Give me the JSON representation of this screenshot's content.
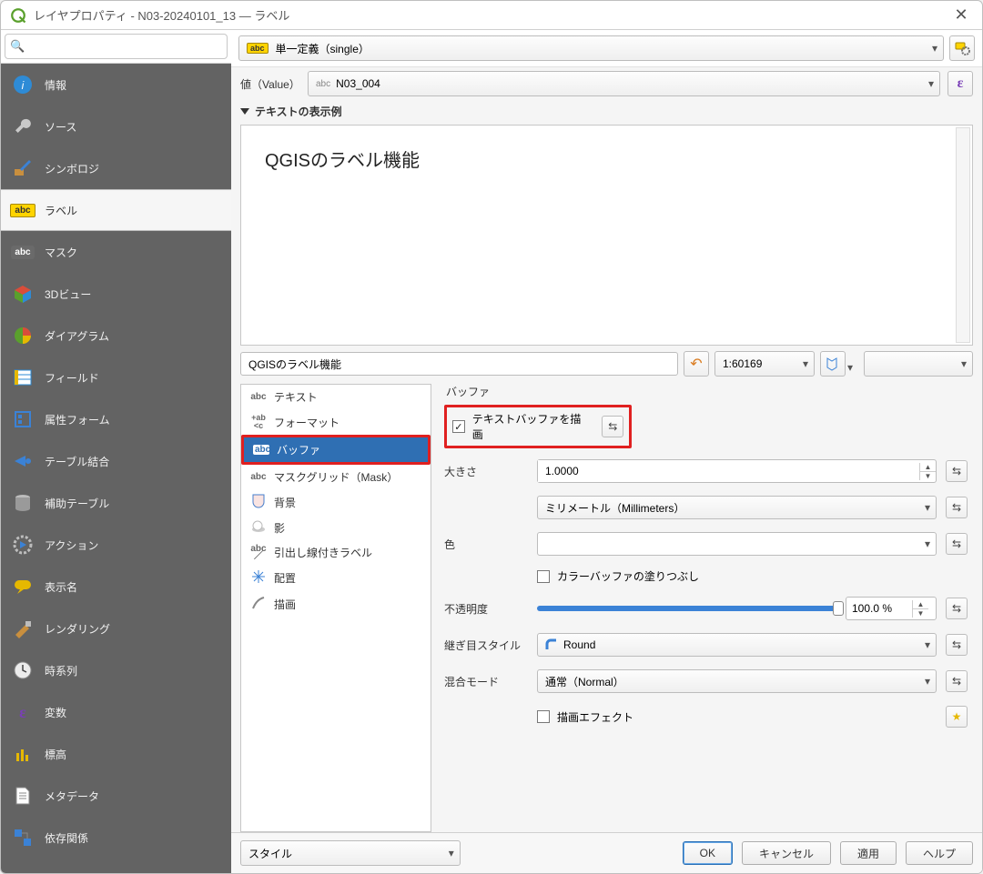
{
  "window": {
    "title": "レイヤプロパティ - N03-20240101_13 — ラベル"
  },
  "sidebar_search_placeholder": "",
  "sidebar": {
    "items": [
      {
        "label": "情報"
      },
      {
        "label": "ソース"
      },
      {
        "label": "シンボロジ"
      },
      {
        "label": "ラベル"
      },
      {
        "label": "マスク"
      },
      {
        "label": "3Dビュー"
      },
      {
        "label": "ダイアグラム"
      },
      {
        "label": "フィールド"
      },
      {
        "label": "属性フォーム"
      },
      {
        "label": "テーブル結合"
      },
      {
        "label": "補助テーブル"
      },
      {
        "label": "アクション"
      },
      {
        "label": "表示名"
      },
      {
        "label": "レンダリング"
      },
      {
        "label": "時系列"
      },
      {
        "label": "変数"
      },
      {
        "label": "標高"
      },
      {
        "label": "メタデータ"
      },
      {
        "label": "依存関係"
      }
    ]
  },
  "mode": {
    "label": "単一定義（single）"
  },
  "value": {
    "label": "値（Value）",
    "field_prefix": "abc",
    "field": "N03_004"
  },
  "preview": {
    "heading": "テキストの表示例",
    "text": "QGISのラベル機能",
    "input": "QGISのラベル機能",
    "scale": "1:60169"
  },
  "tab_tree": [
    {
      "icon": "abc",
      "label": "テキスト"
    },
    {
      "icon": "+ab",
      "label": "フォーマット"
    },
    {
      "icon": "abc",
      "label": "バッファ",
      "selected": true
    },
    {
      "icon": "abc",
      "label": "マスクグリッド（Mask）"
    },
    {
      "icon": "shield",
      "label": "背景"
    },
    {
      "icon": "shadow",
      "label": "影"
    },
    {
      "icon": "callout",
      "label": "引出し線付きラベル"
    },
    {
      "icon": "place",
      "label": "配置"
    },
    {
      "icon": "brush",
      "label": "描画"
    }
  ],
  "buffer": {
    "section": "バッファ",
    "draw_checkbox_label": "テキストバッファを描画",
    "size_label": "大きさ",
    "size_value": "1.0000",
    "unit_value": "ミリメートル（Millimeters）",
    "color_label": "色",
    "fill_checkbox_label": "カラーバッファの塗りつぶし",
    "opacity_label": "不透明度",
    "opacity_value": "100.0 %",
    "join_label": "継ぎ目スタイル",
    "join_value": "Round",
    "blend_label": "混合モード",
    "blend_value": "通常（Normal）",
    "effects_label": "描画エフェクト"
  },
  "buttons": {
    "style": "スタイル",
    "ok": "OK",
    "cancel": "キャンセル",
    "apply": "適用",
    "help": "ヘルプ"
  }
}
